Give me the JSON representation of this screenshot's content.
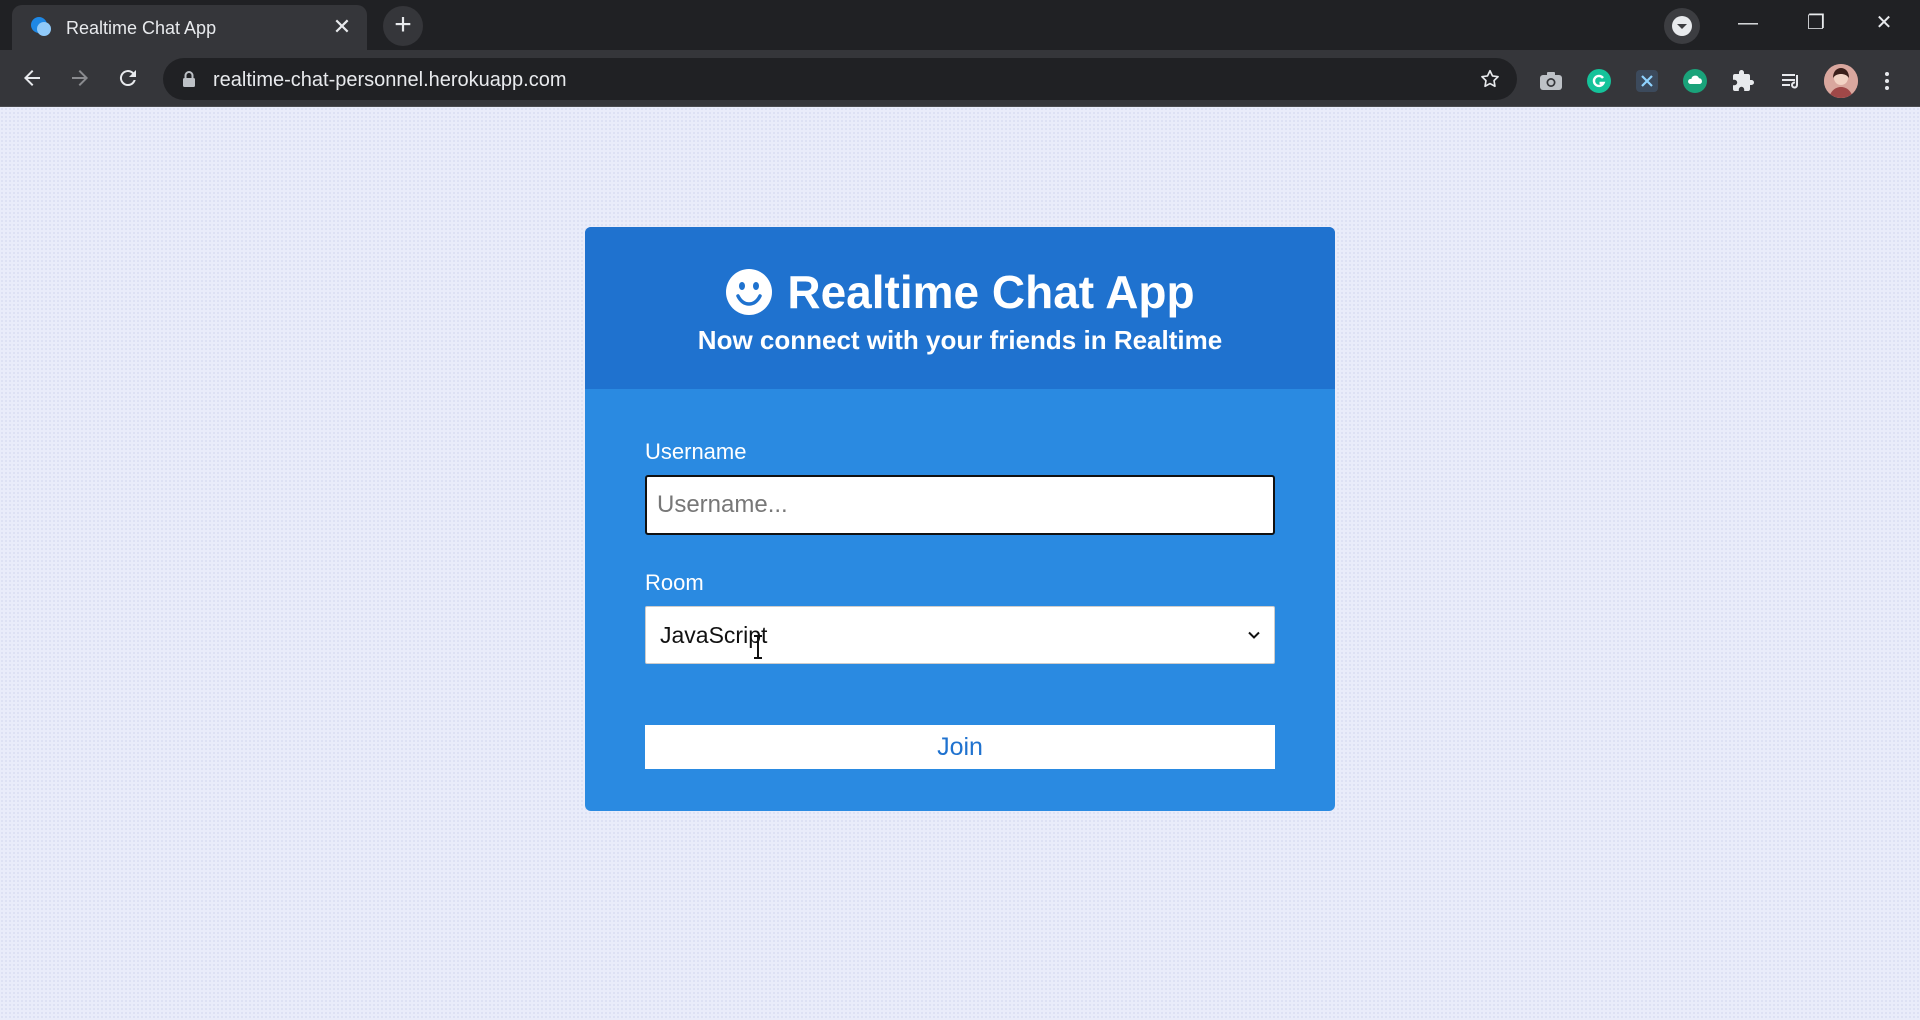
{
  "browser": {
    "tab": {
      "title": "Realtime Chat App",
      "close": "✕"
    },
    "newtab": "+",
    "url": "realtime-chat-personnel.herokuapp.com",
    "window_controls": {
      "minimize": "—",
      "restore": "❐",
      "close": "✕"
    },
    "extensions": [
      "camera-icon",
      "grammarly-icon",
      "x-extension-icon",
      "cloud-extension-icon",
      "puzzle-icon",
      "media-icon",
      "avatar",
      "menu-icon"
    ]
  },
  "app": {
    "title": "Realtime Chat App",
    "subtitle": "Now connect with your friends in Realtime",
    "username_label": "Username",
    "username_placeholder": "Username...",
    "username_value": "",
    "room_label": "Room",
    "room_selected": "JavaScript",
    "join_label": "Join"
  },
  "colors": {
    "header": "#1f72cf",
    "body": "#2a8ae1",
    "page_bg": "#e9ecfa"
  }
}
